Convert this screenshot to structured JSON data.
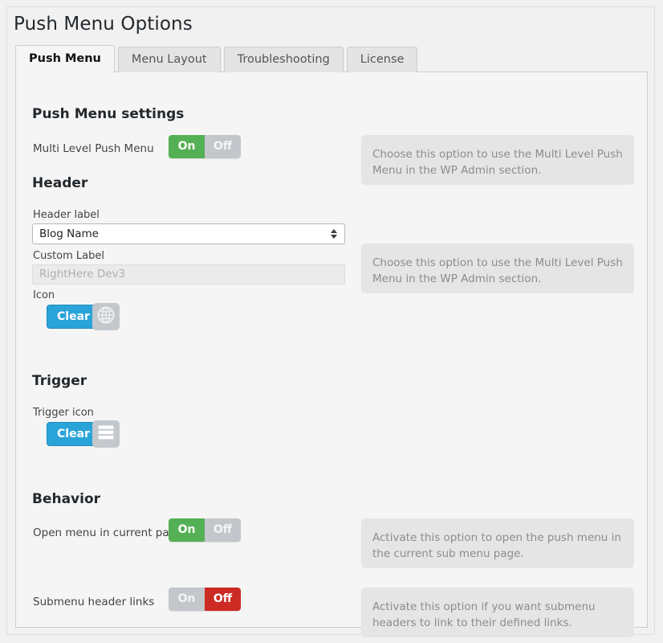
{
  "page": {
    "title": "Push Menu Options"
  },
  "tabs": [
    {
      "label": "Push Menu",
      "active": true
    },
    {
      "label": "Menu Layout",
      "active": false
    },
    {
      "label": "Troubleshooting",
      "active": false
    },
    {
      "label": "License",
      "active": false
    }
  ],
  "sections": {
    "push_menu_settings": {
      "heading": "Push Menu settings",
      "multi_level": {
        "label": "Multi Level Push Menu",
        "on_label": "On",
        "off_label": "Off",
        "state": "On",
        "help": "Choose this option to use the Multi Level Push Menu in the WP Admin section."
      }
    },
    "header": {
      "heading": "Header",
      "header_label": {
        "label": "Header label",
        "value": "Blog Name"
      },
      "custom_label": {
        "label": "Custom Label",
        "placeholder": "RightHere Dev3",
        "value": ""
      },
      "icon": {
        "label": "Icon",
        "clear_label": "Clear",
        "icon_name": "globe-icon"
      },
      "help": "Choose this option to use the Multi Level Push Menu in the WP Admin section."
    },
    "trigger": {
      "heading": "Trigger",
      "trigger_icon": {
        "label": "Trigger icon",
        "clear_label": "Clear",
        "icon_name": "hamburger-icon"
      }
    },
    "behavior": {
      "heading": "Behavior",
      "open_menu": {
        "label": "Open menu in current page",
        "on_label": "On",
        "off_label": "Off",
        "state": "On",
        "help": "Activate this option to open the push menu in the current sub menu page."
      },
      "submenu_links": {
        "label": "Submenu header links",
        "on_label": "On",
        "off_label": "Off",
        "state": "Off",
        "help": "Activate this option if you want submenu headers to link to their defined links."
      }
    }
  },
  "colors": {
    "toggle_on": "#54b054",
    "toggle_off": "#cc2b24",
    "toggle_inactive": "#c3c7cb",
    "clear_button": "#2aa4d8",
    "panel_bg": "#f5f5f5",
    "help_bg": "#e5e5e5"
  }
}
